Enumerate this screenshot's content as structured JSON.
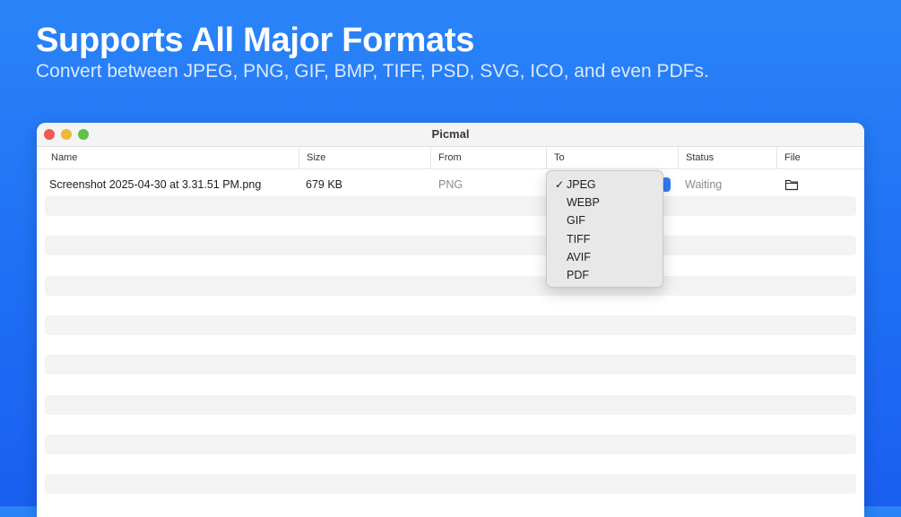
{
  "hero": {
    "title": "Supports All Major Formats",
    "subtitle": "Convert between JPEG, PNG, GIF, BMP, TIFF, PSD, SVG, ICO, and even PDFs."
  },
  "window": {
    "title": "Picmal"
  },
  "table": {
    "columns": [
      "Name",
      "Size",
      "From",
      "To",
      "Status",
      "File"
    ],
    "rows": [
      {
        "name": "Screenshot 2025-04-30 at 3.31.51 PM.png",
        "size": "679 KB",
        "from": "PNG",
        "to": "JPEG",
        "status": "Waiting",
        "file_icon": "folder-icon"
      }
    ]
  },
  "format_menu": {
    "selected": "JPEG",
    "checkmark": "✓",
    "options": [
      "JPEG",
      "WEBP",
      "GIF",
      "TIFF",
      "AVIF",
      "PDF"
    ]
  },
  "colors": {
    "background": "#1f6ff4",
    "accent": "#2f7cf6",
    "close": "#ee5a52",
    "minimize": "#f2b63b",
    "zoom": "#5fc04a"
  }
}
